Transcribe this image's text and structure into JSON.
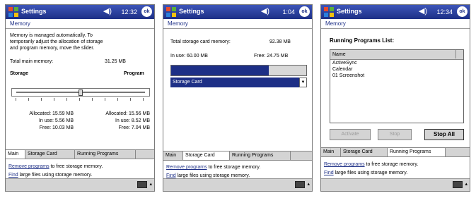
{
  "status": {
    "app_title": "Settings",
    "icons": {
      "start": "windows-start-icon",
      "volume": "speaker-icon",
      "ok": "ok-button"
    },
    "ok_label": "ok"
  },
  "panels": [
    {
      "time": "12:32",
      "heading": "Memory",
      "description": [
        "Memory is managed automatically. To",
        "temporarily adjust the allocation of storage",
        "and program memory, move the slider."
      ],
      "total_label": "Total main memory:",
      "total_value": "31.25 MB",
      "storage_label": "Storage",
      "program_label": "Program",
      "slider_position": 0.5,
      "alloc_left": "Allocated: 15.59 MB",
      "inuse_left": "In use: 5.56 MB",
      "free_left": "Free: 10.03 MB",
      "alloc_right": "Allocated: 15.56 MB",
      "inuse_right": "In use: 8.52 MB",
      "free_right": "Free: 7.04 MB",
      "tabs": [
        "Main",
        "Storage Card",
        "Running Programs"
      ],
      "active_tab": 0,
      "link1": "Remove programs",
      "link1_rest": " to free storage memory.",
      "link2": "Find",
      "link2_rest": " large files using storage memory."
    },
    {
      "time": "1:04",
      "heading": "Memory",
      "total_label": "Total storage card memory:",
      "total_value": "92.38 MB",
      "inuse": "In use: 60.00 MB",
      "free": "Free: 24.75 MB",
      "bar_fill": 0.72,
      "card_option": "Storage Card",
      "tabs": [
        "Main",
        "Storage Card",
        "Running Programs"
      ],
      "active_tab": 1,
      "link1": "Remove programs",
      "link1_rest": " to free storage memory.",
      "link2": "Find",
      "link2_rest": " large files using storage memory."
    },
    {
      "time": "12:34",
      "heading": "Memory",
      "list_title": "Running Programs List:",
      "list_header": "Name",
      "programs": [
        "ActiveSync",
        "Calendar",
        "01 Screenshot"
      ],
      "activate_label": "Activate",
      "stop_label": "Stop",
      "stop_all_label": "Stop All",
      "tabs": [
        "Main",
        "Storage Card",
        "Running Programs"
      ],
      "active_tab": 2,
      "link1": "Remove programs",
      "link1_rest": " to free storage memory.",
      "link2": "Find",
      "link2_rest": " large files using storage memory."
    }
  ],
  "colors": {
    "titlebar": "#1d2f86",
    "accent": "#1d2f86",
    "tabbar": "#d4d4d4"
  }
}
